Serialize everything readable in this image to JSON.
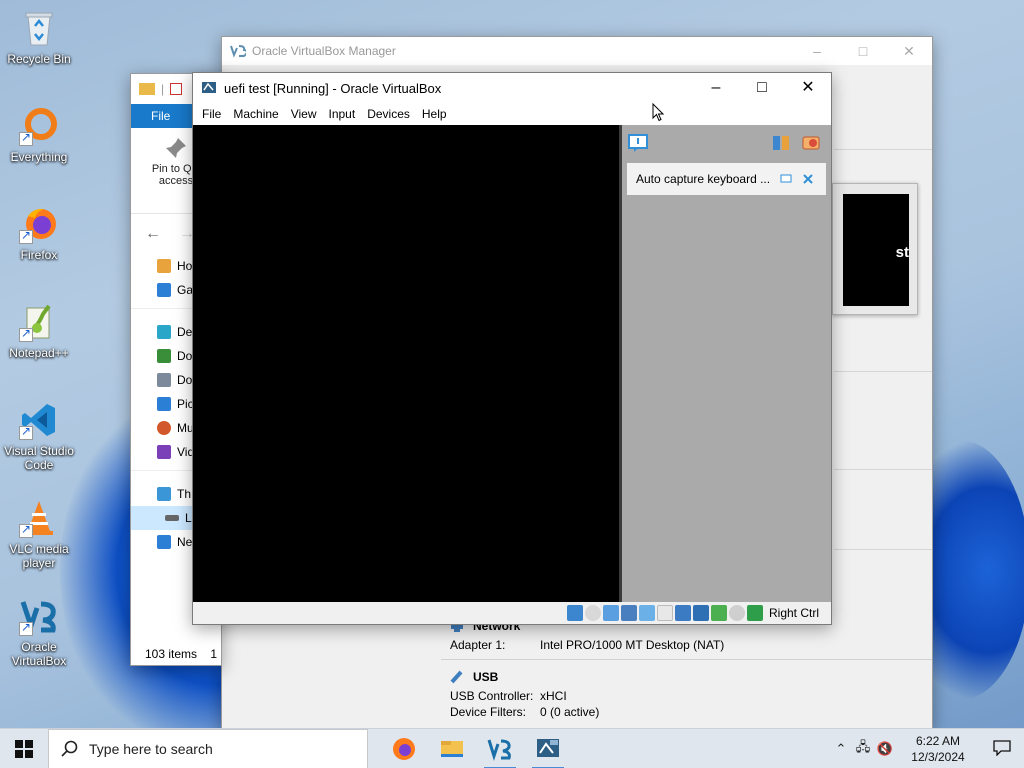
{
  "desktop": {
    "icons": [
      {
        "label": "Recycle Bin",
        "icon": "recycle-bin-icon"
      },
      {
        "label": "Everything",
        "icon": "everything-icon"
      },
      {
        "label": "Firefox",
        "icon": "firefox-icon"
      },
      {
        "label": "Notepad++",
        "icon": "notepadpp-icon"
      },
      {
        "label": "Visual Studio Code",
        "icon": "vscode-icon"
      },
      {
        "label": "VLC media player",
        "icon": "vlc-icon"
      },
      {
        "label": "Oracle VirtualBox",
        "icon": "virtualbox-icon"
      }
    ]
  },
  "manager": {
    "title": "Oracle VirtualBox Manager",
    "preview_text": "st",
    "network": {
      "heading": "Network",
      "adapter_key": "Adapter 1:",
      "adapter_val": "Intel PRO/1000 MT Desktop (NAT)"
    },
    "usb": {
      "heading": "USB",
      "controller_key": "USB Controller:",
      "controller_val": "xHCI",
      "filters_key": "Device Filters:",
      "filters_val": "0 (0 active)"
    }
  },
  "explorer": {
    "ribbon_tab": "File",
    "pin_label": "Pin to Quick access",
    "pin_label_visible_1": "Pin to Qui",
    "pin_label_visible_2": "access",
    "tree": [
      {
        "label": "Ho",
        "icon": "home-icon",
        "color": "#e8a33d"
      },
      {
        "label": "Ga",
        "icon": "gallery-icon",
        "color": "#2b7fd4"
      },
      {
        "label": "De",
        "icon": "desktop-folder-icon",
        "color": "#2aa6c9"
      },
      {
        "label": "Do",
        "icon": "downloads-icon",
        "color": "#3a8e3a"
      },
      {
        "label": "Do",
        "icon": "documents-icon",
        "color": "#7d8a99"
      },
      {
        "label": "Pic",
        "icon": "pictures-icon",
        "color": "#2b7fd4"
      },
      {
        "label": "Mu",
        "icon": "music-icon",
        "color": "#d2572b"
      },
      {
        "label": "Vid",
        "icon": "videos-icon",
        "color": "#7b3fb8"
      },
      {
        "label": "Th",
        "icon": "this-pc-icon",
        "color": "#3a96d6"
      },
      {
        "label": "L",
        "icon": "drive-icon",
        "color": "#555"
      },
      {
        "label": "Ne",
        "icon": "network-icon",
        "color": "#2b7fd4"
      }
    ],
    "status_items": "103 items",
    "status_extra": "1"
  },
  "vm": {
    "title": "uefi test [Running] - Oracle VirtualBox",
    "menu": [
      "File",
      "Machine",
      "View",
      "Input",
      "Devices",
      "Help"
    ],
    "notice_text": "Auto capture keyboard ...",
    "host_key": "Right Ctrl"
  },
  "taskbar": {
    "search_placeholder": "Type here to search",
    "time": "6:22 AM",
    "date": "12/3/2024",
    "apps": [
      "firefox-icon",
      "file-explorer-icon",
      "virtualbox-icon",
      "virtualbox-vm-icon"
    ]
  },
  "colors": {
    "accent": "#1979ca",
    "vm_panel": "#aaaaaa",
    "taskbar": "#dfe6ee"
  }
}
